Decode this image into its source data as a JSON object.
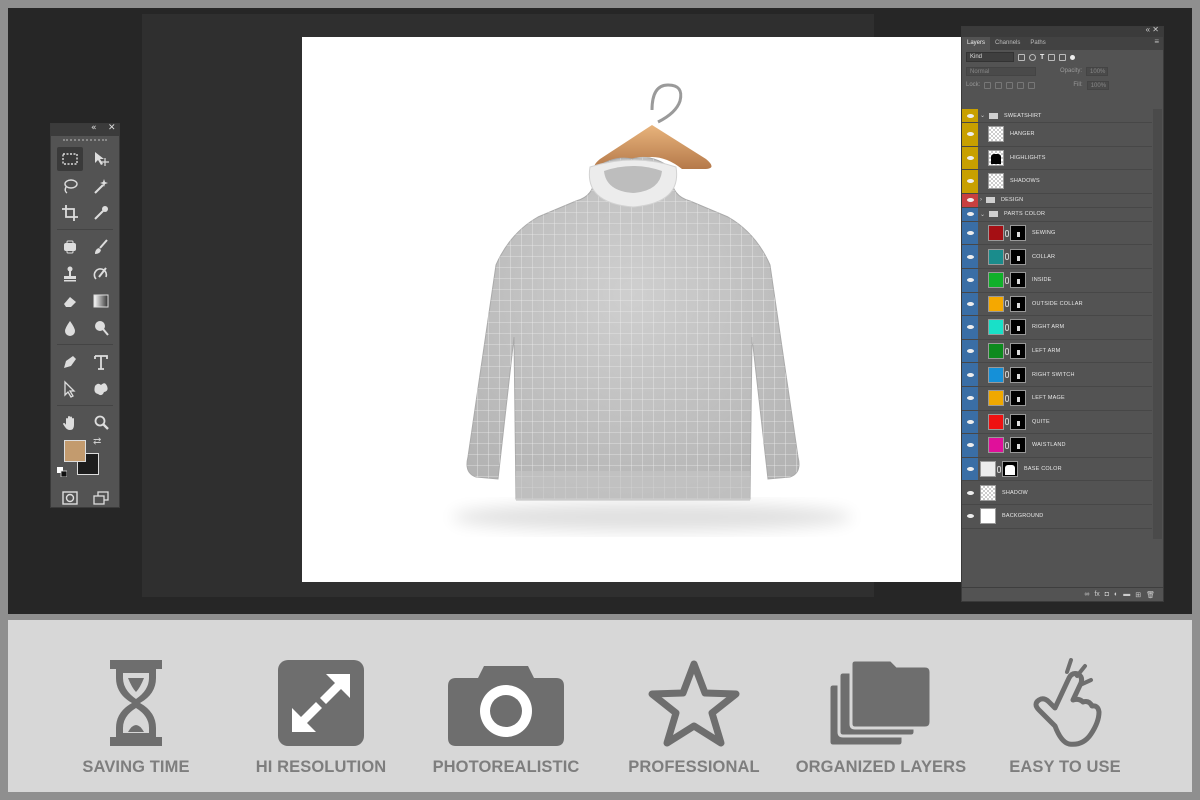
{
  "layers_panel": {
    "tabs": [
      "Layers",
      "Channels",
      "Paths"
    ],
    "filter_kind": "Kind",
    "blend_mode": "Normal",
    "opacity_label": "Opacity:",
    "opacity_value": "100%",
    "lock_label": "Lock:",
    "fill_label": "Fill:",
    "fill_value": "100%",
    "layers": [
      {
        "name": "SWEATSHIRT",
        "kind": "group",
        "tag": "#c8a000"
      },
      {
        "name": "HANGER",
        "kind": "layer",
        "tag": "#c8a000",
        "thumb": "checker"
      },
      {
        "name": "HIGHLIGHTS",
        "kind": "layer",
        "tag": "#c8a000",
        "thumb": "shirt"
      },
      {
        "name": "SHADOWS",
        "kind": "layer",
        "tag": "#c8a000",
        "thumb": "checker"
      },
      {
        "name": "DESIGN",
        "kind": "group",
        "tag": "#c84040"
      },
      {
        "name": "PARTS COLOR",
        "kind": "group",
        "tag": "#3a6ea5"
      },
      {
        "name": "SEWING",
        "kind": "fill",
        "tag": "#3a6ea5",
        "color": "#a50f14"
      },
      {
        "name": "COLLAR",
        "kind": "fill",
        "tag": "#3a6ea5",
        "color": "#1a8c8c"
      },
      {
        "name": "INSIDE",
        "kind": "fill",
        "tag": "#3a6ea5",
        "color": "#10b02a"
      },
      {
        "name": "OUTSIDE COLLAR",
        "kind": "fill",
        "tag": "#3a6ea5",
        "color": "#f5a800"
      },
      {
        "name": "RIGHT ARM",
        "kind": "fill",
        "tag": "#3a6ea5",
        "color": "#19e0c8"
      },
      {
        "name": "LEFT ARM",
        "kind": "fill",
        "tag": "#3a6ea5",
        "color": "#0d8a1e"
      },
      {
        "name": "RIGHT SWITCH",
        "kind": "fill",
        "tag": "#3a6ea5",
        "color": "#1590d8"
      },
      {
        "name": "LEFT MAGE",
        "kind": "fill",
        "tag": "#3a6ea5",
        "color": "#f0a800"
      },
      {
        "name": "QUITE",
        "kind": "fill",
        "tag": "#3a6ea5",
        "color": "#ee1111"
      },
      {
        "name": "WAISTLAND",
        "kind": "fill",
        "tag": "#3a6ea5",
        "color": "#e0109a"
      },
      {
        "name": "BASE COLOR",
        "kind": "base",
        "tag": "#3a6ea5",
        "color": "#ececec"
      },
      {
        "name": "SHADOW",
        "kind": "layer",
        "tag": "",
        "thumb": "checker"
      },
      {
        "name": "BACKGROUND",
        "kind": "layer",
        "tag": "",
        "thumb": "white"
      }
    ]
  },
  "features": [
    {
      "label": "SAVING TIME",
      "icon": "hourglass-icon"
    },
    {
      "label": "HI RESOLUTION",
      "icon": "expand-icon"
    },
    {
      "label": "PHOTOREALISTIC",
      "icon": "camera-icon"
    },
    {
      "label": "PROFESSIONAL",
      "icon": "star-icon"
    },
    {
      "label": "ORGANIZED LAYERS",
      "icon": "layers-folder-icon"
    },
    {
      "label": "EASY TO USE",
      "icon": "hand-tap-icon"
    }
  ],
  "colors": {
    "foreground": "#c39b6e",
    "background": "#1d1d1d",
    "feature_icon": "#6e6e6e"
  }
}
